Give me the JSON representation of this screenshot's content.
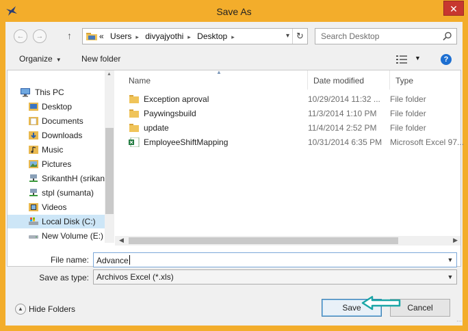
{
  "window": {
    "title": "Save As",
    "close_label": "✕",
    "accent": "#f3ad2b"
  },
  "nav": {
    "back_icon": "back-arrow-icon",
    "forward_icon": "forward-arrow-icon",
    "up_icon": "up-arrow-icon",
    "breadcrumb": [
      "«",
      "Users",
      "divyajyothi",
      "Desktop"
    ],
    "search_placeholder": "Search Desktop"
  },
  "toolbar": {
    "organize_label": "Organize",
    "new_folder_label": "New folder",
    "help_label": "?"
  },
  "sidebar": {
    "items": [
      {
        "label": "This PC",
        "icon": "computer-icon"
      },
      {
        "label": "Desktop",
        "icon": "desktop-folder-icon"
      },
      {
        "label": "Documents",
        "icon": "documents-folder-icon"
      },
      {
        "label": "Downloads",
        "icon": "downloads-folder-icon"
      },
      {
        "label": "Music",
        "icon": "music-folder-icon"
      },
      {
        "label": "Pictures",
        "icon": "pictures-folder-icon"
      },
      {
        "label": "SrikanthH (srikan",
        "icon": "network-drive-icon"
      },
      {
        "label": "stpl (sumanta)",
        "icon": "network-drive-icon"
      },
      {
        "label": "Videos",
        "icon": "videos-folder-icon"
      },
      {
        "label": "Local Disk (C:)",
        "icon": "local-disk-icon",
        "selected": true
      },
      {
        "label": "New Volume (E:)",
        "icon": "drive-icon"
      }
    ]
  },
  "files": {
    "columns": [
      "Name",
      "Date modified",
      "Type"
    ],
    "rows": [
      {
        "name": "Exception aproval",
        "date": "10/29/2014 11:32 ...",
        "type": "File folder",
        "icon": "folder-icon"
      },
      {
        "name": "Paywingsbuild",
        "date": "11/3/2014 1:10 PM",
        "type": "File folder",
        "icon": "folder-icon"
      },
      {
        "name": "update",
        "date": "11/4/2014 2:52 PM",
        "type": "File folder",
        "icon": "folder-icon"
      },
      {
        "name": "EmployeeShiftMapping",
        "date": "10/31/2014 6:35 PM",
        "type": "Microsoft Excel 97...",
        "icon": "excel-file-icon"
      }
    ]
  },
  "form": {
    "file_name_label": "File name:",
    "file_name_value": "Advance",
    "save_type_label": "Save as type:",
    "save_type_value": "Archivos Excel (*.xls)"
  },
  "footer": {
    "hide_folders_label": "Hide Folders",
    "save_label": "Save",
    "cancel_label": "Cancel"
  }
}
